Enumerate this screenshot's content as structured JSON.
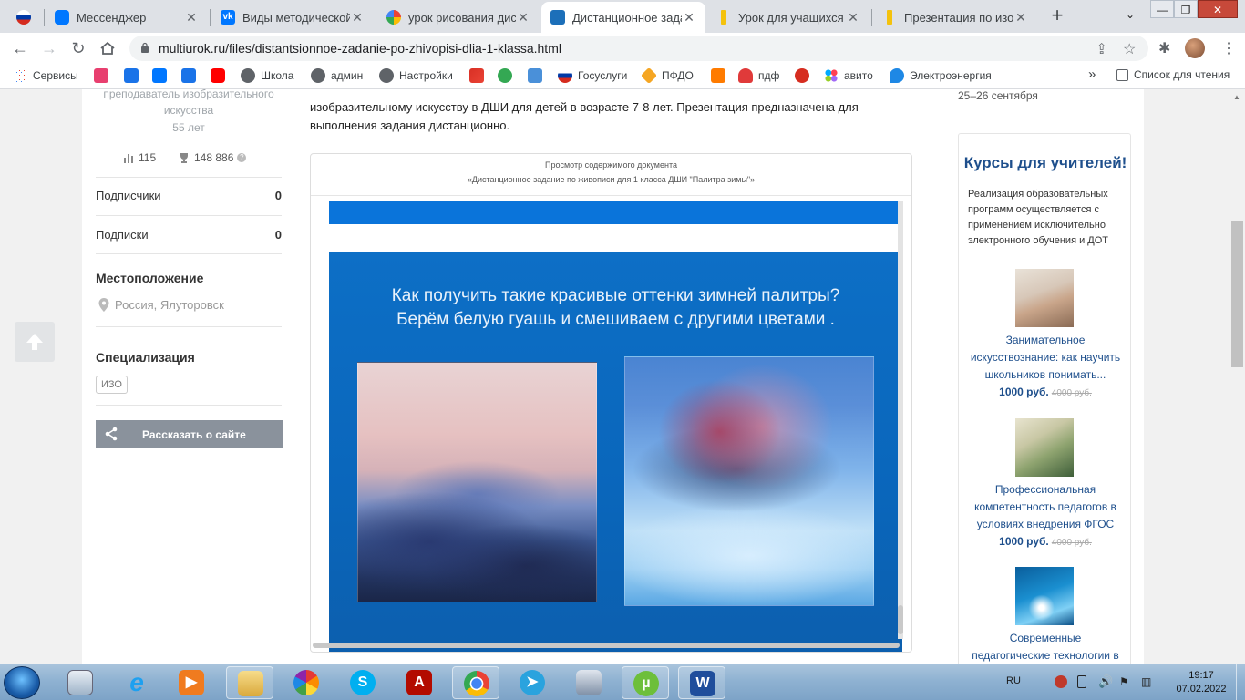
{
  "browser": {
    "tabs": [
      {
        "title": "",
        "color": "#ffffff"
      },
      {
        "title": "Мессенджер",
        "color": "#0077ff"
      },
      {
        "title": "Виды методической р",
        "color": "#0077ff"
      },
      {
        "title": "урок рисования дист",
        "color": "#4285f4"
      },
      {
        "title": "Дистанционное задан",
        "color": "#1c6fb9"
      },
      {
        "title": "Урок для учащихся ху",
        "color": "#f4c20d"
      },
      {
        "title": "Презентация по изобр",
        "color": "#f4c20d"
      }
    ],
    "window_controls": {
      "minimize": "—",
      "maximize": "❐",
      "close": "✕"
    },
    "address": {
      "url": "multiurok.ru/files/distantsionnoe-zadanie-po-zhivopisi-dlia-1-klassa.html"
    },
    "bookmarks": [
      {
        "label": "Сервисы",
        "color": "#4285f4"
      },
      {
        "label": "",
        "color": "#e83f6f"
      },
      {
        "label": "",
        "color": "#1a73e8"
      },
      {
        "label": "",
        "color": "#0077ff"
      },
      {
        "label": "",
        "color": "#1a73e8"
      },
      {
        "label": "",
        "color": "#ff0000"
      },
      {
        "label": "Школа",
        "color": "#5f6368"
      },
      {
        "label": "админ",
        "color": "#5f6368"
      },
      {
        "label": "Настройки",
        "color": "#5f6368"
      },
      {
        "label": "",
        "color": "#d93025"
      },
      {
        "label": "",
        "color": "#34a853"
      },
      {
        "label": "",
        "color": "#4a90d9"
      },
      {
        "label": "Госуслуги",
        "color": "#d52b1e"
      },
      {
        "label": "ПФДО",
        "color": "#f5a623"
      },
      {
        "label": "",
        "color": "#ff7b00"
      },
      {
        "label": "пдф",
        "color": "#e03a3a"
      },
      {
        "label": "",
        "color": "#d62d20"
      },
      {
        "label": "авито",
        "color": "#9b59b6"
      },
      {
        "label": "Электроэнергия",
        "color": "#1e88e5"
      }
    ],
    "overflow": "»",
    "reading_list": "Список для чтения"
  },
  "left_column": {
    "role_line1": "преподаватель изобразительного",
    "role_line2": "искусства",
    "age": "55 лет",
    "stats": {
      "materials": "115",
      "rating": "148 886"
    },
    "subscribers_label": "Подписчики",
    "subscribers_value": "0",
    "subscriptions_label": "Подписки",
    "subscriptions_value": "0",
    "location_heading": "Местоположение",
    "location": "Россия, Ялуторовск",
    "specialization_heading": "Специализация",
    "specialization_tag": "ИЗО",
    "share_button": "Рассказать о сайте"
  },
  "center": {
    "description_line1": "изобразительному искусству в ДШИ для детей в возрасте 7-8 лет.      Презентация предназначена для",
    "description_line2": "выполнения задания дистанционно.",
    "preview_label": "Просмотр содержимого документа",
    "preview_doc_title": "«Дистанционное задание по живописи для 1 класса ДШИ \"Палитра зимы\"»",
    "slide_title_line1": "Как получить такие красивые оттенки зимней палитры?",
    "slide_title_line2": "Берём белую гуашь и  смешиваем с другими цветами ."
  },
  "right_column": {
    "event_date": "25–26 сентября",
    "courses_title": "Курсы для учителей!",
    "courses_intro": "Реализация образовательных программ осуществляется с применением исключительно электронного обучения и ДОТ",
    "courses": [
      {
        "name_line1": "Занимательное",
        "name_line2": "искусствознание: как научить",
        "name_line3": "школьников понимать...",
        "price": "1000 руб.",
        "old_price": "4000 руб."
      },
      {
        "name_line1": "Профессиональная",
        "name_line2": "компетентность педагогов в",
        "name_line3": "условиях внедрения ФГОС",
        "price": "1000 руб.",
        "old_price": "4000 руб."
      },
      {
        "name_line1": "Современные",
        "name_line2": "педагогические технологии в",
        "name_line3": "",
        "price": "",
        "old_price": ""
      }
    ]
  },
  "taskbar": {
    "language": "RU",
    "time": "19:17",
    "date": "07.02.2022"
  }
}
